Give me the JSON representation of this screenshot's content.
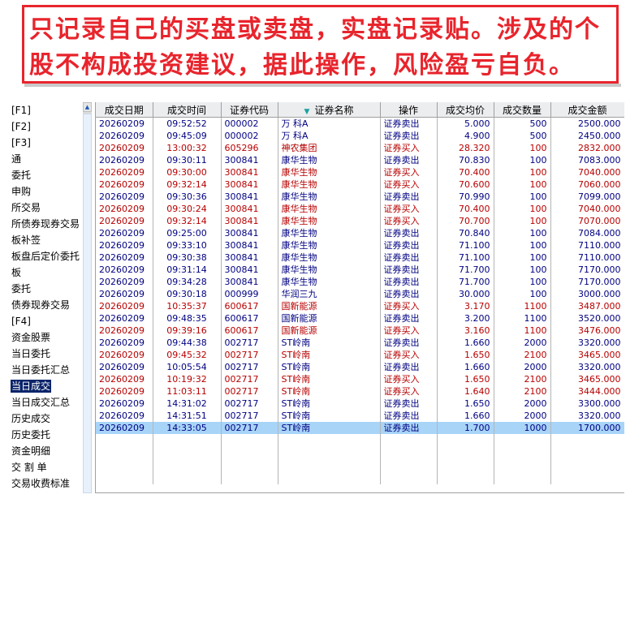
{
  "banner": {
    "line1": "只记录自己的买盘或卖盘，实盘记录贴。涉及的个",
    "line2": "股不构成投资建议，据此操作，风险盈亏自负。"
  },
  "sidebar": {
    "items": [
      {
        "label": "[F1]"
      },
      {
        "label": "[F2]"
      },
      {
        "label": "[F3]"
      },
      {
        "label": "通"
      },
      {
        "label": "委托"
      },
      {
        "label": "申购"
      },
      {
        "label": "所交易"
      },
      {
        "label": "所债券现券交易"
      },
      {
        "label": "板补签"
      },
      {
        "label": "板盘后定价委托"
      },
      {
        "label": "板"
      },
      {
        "label": "委托"
      },
      {
        "label": "债券现券交易"
      },
      {
        "label": "[F4]"
      },
      {
        "label": "资金股票"
      },
      {
        "label": "当日委托"
      },
      {
        "label": "当日委托汇总"
      },
      {
        "label": "当日成交",
        "selected": true
      },
      {
        "label": "当日成交汇总"
      },
      {
        "label": "历史成交"
      },
      {
        "label": "历史委托"
      },
      {
        "label": "资金明细"
      },
      {
        "label": "交 割 单"
      },
      {
        "label": "交易收费标准"
      }
    ],
    "scroll_up_icon": "triangle-up-icon"
  },
  "table": {
    "sort_icon": "sort-desc-icon",
    "columns": [
      "成交日期",
      "成交时间",
      "证券代码",
      "证券名称",
      "操作",
      "成交均价",
      "成交数量",
      "成交金额"
    ],
    "rows": [
      {
        "date": "20260209",
        "time": "09:52:52",
        "code": "000002",
        "name": "万 科A",
        "op": "证券卖出",
        "avg": "5.000",
        "qty": "500",
        "amt": "2500.000",
        "type": "sell"
      },
      {
        "date": "20260209",
        "time": "09:45:09",
        "code": "000002",
        "name": "万 科A",
        "op": "证券卖出",
        "avg": "4.900",
        "qty": "500",
        "amt": "2450.000",
        "type": "sell"
      },
      {
        "date": "20260209",
        "time": "13:00:32",
        "code": "605296",
        "name": "神农集团",
        "op": "证券买入",
        "avg": "28.320",
        "qty": "100",
        "amt": "2832.000",
        "type": "buy"
      },
      {
        "date": "20260209",
        "time": "09:30:11",
        "code": "300841",
        "name": "康华生物",
        "op": "证券卖出",
        "avg": "70.830",
        "qty": "100",
        "amt": "7083.000",
        "type": "sell"
      },
      {
        "date": "20260209",
        "time": "09:30:00",
        "code": "300841",
        "name": "康华生物",
        "op": "证券买入",
        "avg": "70.400",
        "qty": "100",
        "amt": "7040.000",
        "type": "buy"
      },
      {
        "date": "20260209",
        "time": "09:32:14",
        "code": "300841",
        "name": "康华生物",
        "op": "证券买入",
        "avg": "70.600",
        "qty": "100",
        "amt": "7060.000",
        "type": "buy"
      },
      {
        "date": "20260209",
        "time": "09:30:36",
        "code": "300841",
        "name": "康华生物",
        "op": "证券卖出",
        "avg": "70.990",
        "qty": "100",
        "amt": "7099.000",
        "type": "sell"
      },
      {
        "date": "20260209",
        "time": "09:30:24",
        "code": "300841",
        "name": "康华生物",
        "op": "证券买入",
        "avg": "70.400",
        "qty": "100",
        "amt": "7040.000",
        "type": "buy"
      },
      {
        "date": "20260209",
        "time": "09:32:14",
        "code": "300841",
        "name": "康华生物",
        "op": "证券买入",
        "avg": "70.700",
        "qty": "100",
        "amt": "7070.000",
        "type": "buy"
      },
      {
        "date": "20260209",
        "time": "09:25:00",
        "code": "300841",
        "name": "康华生物",
        "op": "证券卖出",
        "avg": "70.840",
        "qty": "100",
        "amt": "7084.000",
        "type": "sell"
      },
      {
        "date": "20260209",
        "time": "09:33:10",
        "code": "300841",
        "name": "康华生物",
        "op": "证券卖出",
        "avg": "71.100",
        "qty": "100",
        "amt": "7110.000",
        "type": "sell"
      },
      {
        "date": "20260209",
        "time": "09:30:38",
        "code": "300841",
        "name": "康华生物",
        "op": "证券卖出",
        "avg": "71.100",
        "qty": "100",
        "amt": "7110.000",
        "type": "sell"
      },
      {
        "date": "20260209",
        "time": "09:31:14",
        "code": "300841",
        "name": "康华生物",
        "op": "证券卖出",
        "avg": "71.700",
        "qty": "100",
        "amt": "7170.000",
        "type": "sell"
      },
      {
        "date": "20260209",
        "time": "09:34:28",
        "code": "300841",
        "name": "康华生物",
        "op": "证券卖出",
        "avg": "71.700",
        "qty": "100",
        "amt": "7170.000",
        "type": "sell"
      },
      {
        "date": "20260209",
        "time": "09:30:18",
        "code": "000999",
        "name": "华润三九",
        "op": "证券卖出",
        "avg": "30.000",
        "qty": "100",
        "amt": "3000.000",
        "type": "sell"
      },
      {
        "date": "20260209",
        "time": "10:35:37",
        "code": "600617",
        "name": "国新能源",
        "op": "证券买入",
        "avg": "3.170",
        "qty": "1100",
        "amt": "3487.000",
        "type": "buy"
      },
      {
        "date": "20260209",
        "time": "09:48:35",
        "code": "600617",
        "name": "国新能源",
        "op": "证券卖出",
        "avg": "3.200",
        "qty": "1100",
        "amt": "3520.000",
        "type": "sell"
      },
      {
        "date": "20260209",
        "time": "09:39:16",
        "code": "600617",
        "name": "国新能源",
        "op": "证券买入",
        "avg": "3.160",
        "qty": "1100",
        "amt": "3476.000",
        "type": "buy"
      },
      {
        "date": "20260209",
        "time": "09:44:38",
        "code": "002717",
        "name": "ST岭南",
        "op": "证券卖出",
        "avg": "1.660",
        "qty": "2000",
        "amt": "3320.000",
        "type": "sell"
      },
      {
        "date": "20260209",
        "time": "09:45:32",
        "code": "002717",
        "name": "ST岭南",
        "op": "证券买入",
        "avg": "1.650",
        "qty": "2100",
        "amt": "3465.000",
        "type": "buy"
      },
      {
        "date": "20260209",
        "time": "10:05:54",
        "code": "002717",
        "name": "ST岭南",
        "op": "证券卖出",
        "avg": "1.660",
        "qty": "2000",
        "amt": "3320.000",
        "type": "sell"
      },
      {
        "date": "20260209",
        "time": "10:19:32",
        "code": "002717",
        "name": "ST岭南",
        "op": "证券买入",
        "avg": "1.650",
        "qty": "2100",
        "amt": "3465.000",
        "type": "buy"
      },
      {
        "date": "20260209",
        "time": "11:03:11",
        "code": "002717",
        "name": "ST岭南",
        "op": "证券买入",
        "avg": "1.640",
        "qty": "2100",
        "amt": "3444.000",
        "type": "buy"
      },
      {
        "date": "20260209",
        "time": "14:31:02",
        "code": "002717",
        "name": "ST岭南",
        "op": "证券卖出",
        "avg": "1.650",
        "qty": "2000",
        "amt": "3300.000",
        "type": "sell"
      },
      {
        "date": "20260209",
        "time": "14:31:51",
        "code": "002717",
        "name": "ST岭南",
        "op": "证券卖出",
        "avg": "1.660",
        "qty": "2000",
        "amt": "3320.000",
        "type": "sell"
      },
      {
        "date": "20260209",
        "time": "14:33:05",
        "code": "002717",
        "name": "ST岭南",
        "op": "证券卖出",
        "avg": "1.700",
        "qty": "1000",
        "amt": "1700.000",
        "type": "sell",
        "selected": true
      }
    ]
  },
  "colors": {
    "banner_red": "#e8242c",
    "buy_text": "#b70000",
    "sell_text": "#000080",
    "selected_row": "#a8d4f8",
    "selected_menu": "#0a246a"
  }
}
